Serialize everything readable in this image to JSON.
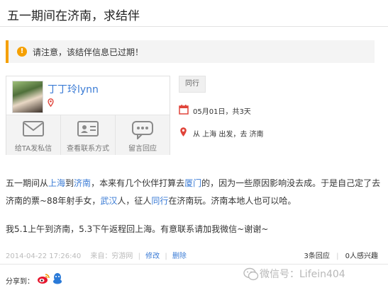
{
  "header": {
    "title": "五一期间在济南，求结伴"
  },
  "notice": {
    "text": "请注意，该结伴信息已过期！"
  },
  "profile": {
    "username": "丁丁玲lynn",
    "actions": [
      {
        "label": "给TA发私信",
        "icon": "envelope-icon"
      },
      {
        "label": "查看联系方式",
        "icon": "contact-card-icon"
      },
      {
        "label": "留言回应",
        "icon": "chat-bubble-icon"
      }
    ]
  },
  "trip": {
    "tag": "同行",
    "date": "05月01日，共3天",
    "route": "从 上海   出发，去 济南"
  },
  "body": {
    "p1_a": "五一期间从",
    "p1_link1": "上海",
    "p1_b": "到",
    "p1_link2": "济南",
    "p1_c": "，本来有几个伙伴打算去",
    "p1_link3": "厦门",
    "p1_d": "的，因为一些原因影响没去成。于是自己定了去济南的票~88年射手女，",
    "p1_link4": "武汉",
    "p1_e": "人，征人",
    "p1_link5": "同行",
    "p1_f": "在济南玩。济南本地人也可以哈。",
    "p2": "我5.1上午到济南，5.3下午返程回上海。有意联系请加我微信~谢谢~"
  },
  "meta": {
    "timestamp": "2014-04-22 17:26:40",
    "source": "来自：穷游网",
    "edit": "修改",
    "delete": "删除",
    "replies": "3条回应",
    "interested": "0人感兴趣"
  },
  "share": {
    "label": "分享到："
  },
  "watermark": {
    "text": "微信号：Lifein404"
  },
  "colors": {
    "accent": "#f5a000",
    "link": "#3a7bd5",
    "pin": "#e0443a"
  }
}
